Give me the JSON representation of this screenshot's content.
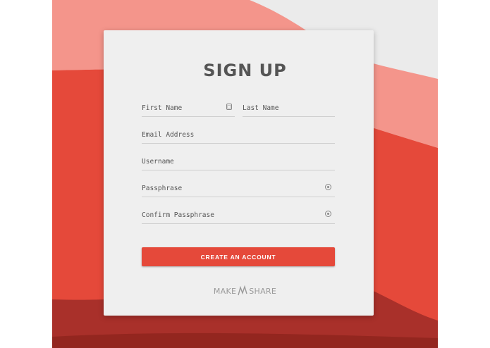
{
  "form": {
    "title": "SIGN UP",
    "first_name_placeholder": "First Name",
    "last_name_placeholder": "Last Name",
    "email_placeholder": "Email Address",
    "username_placeholder": "Username",
    "password_placeholder": "Passphrase",
    "confirm_password_placeholder": "Confirm Passphrase",
    "submit_label": "CREATE AN ACCOUNT"
  },
  "brand": {
    "left": "MAKE",
    "right": "SHARE"
  },
  "colors": {
    "accent": "#e5493a",
    "background_light": "#f4958b",
    "background_mid": "#e5493a",
    "background_dark": "#a9302a",
    "card": "#efefef"
  },
  "icons": {
    "name_field": "id-card-icon",
    "password_field": "eye-icon",
    "brand_mark": "logo-mark-icon"
  }
}
